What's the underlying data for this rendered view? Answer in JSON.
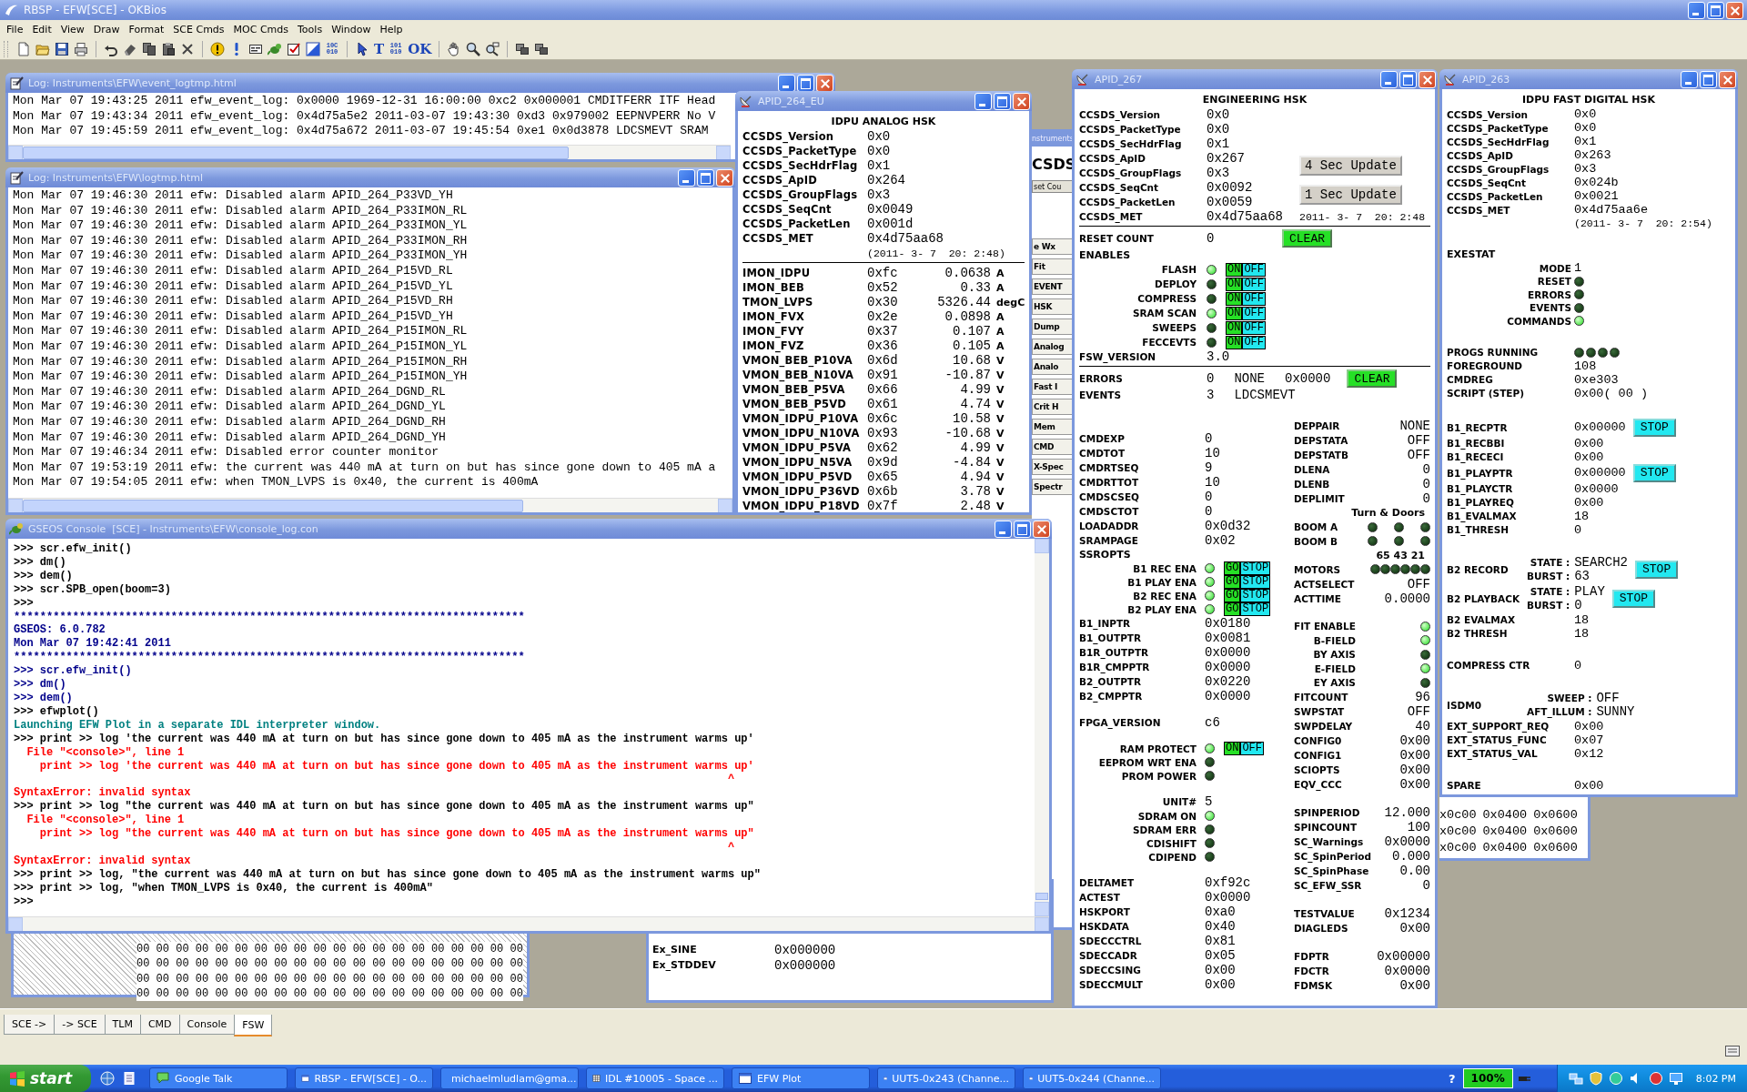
{
  "app": {
    "title": "RBSP - EFW[SCE] - OKBios",
    "menu": [
      "File",
      "Edit",
      "View",
      "Draw",
      "Format",
      "SCE Cmds",
      "MOC Cmds",
      "Tools",
      "Window",
      "Help"
    ],
    "toolbar": [
      {
        "kind": "new"
      },
      {
        "kind": "open"
      },
      {
        "kind": "save"
      },
      {
        "kind": "print"
      },
      {
        "kind": "sep"
      },
      {
        "kind": "undo"
      },
      {
        "kind": "eraser"
      },
      {
        "kind": "copy"
      },
      {
        "kind": "paste"
      },
      {
        "kind": "delete"
      },
      {
        "kind": "sep"
      },
      {
        "kind": "warning"
      },
      {
        "kind": "info"
      },
      {
        "kind": "terminal"
      },
      {
        "kind": "lizard"
      },
      {
        "kind": "check"
      },
      {
        "kind": "chart"
      },
      {
        "kind": "text",
        "text": "10C 010"
      },
      {
        "kind": "sep"
      },
      {
        "kind": "pointer"
      },
      {
        "kind": "text",
        "text": "T"
      },
      {
        "kind": "text",
        "text": "101 010"
      },
      {
        "kind": "text",
        "text": "OK"
      },
      {
        "kind": "sep"
      },
      {
        "kind": "hand"
      },
      {
        "kind": "zoom"
      },
      {
        "kind": "zoomlist"
      },
      {
        "kind": "sep"
      },
      {
        "kind": "tile"
      },
      {
        "kind": "tile"
      }
    ]
  },
  "event_log": {
    "title": "Log: Instruments\\EFW\\event_logtmp.html",
    "lines": [
      "Mon Mar 07 19:43:25 2011 efw_event_log: 0x0000 1969-12-31 16:00:00 0xc2 0x000001 CMDITFERR ITF Head",
      "Mon Mar 07 19:43:34 2011 efw_event_log: 0x4d75a5e2 2011-03-07 19:43:30 0xd3 0x979002 EEPNVPERR No V",
      "Mon Mar 07 19:45:59 2011 efw_event_log: 0x4d75a672 2011-03-07 19:45:54 0xe1 0x0d3878 LDCSMEVT SRAM"
    ]
  },
  "log": {
    "title": "Log: Instruments\\EFW\\logtmp.html",
    "lines": [
      "Mon Mar 07 19:46:30 2011 efw: Disabled alarm APID_264_P33VD_YH",
      "Mon Mar 07 19:46:30 2011 efw: Disabled alarm APID_264_P33IMON_RL",
      "Mon Mar 07 19:46:30 2011 efw: Disabled alarm APID_264_P33IMON_YL",
      "Mon Mar 07 19:46:30 2011 efw: Disabled alarm APID_264_P33IMON_RH",
      "Mon Mar 07 19:46:30 2011 efw: Disabled alarm APID_264_P33IMON_YH",
      "Mon Mar 07 19:46:30 2011 efw: Disabled alarm APID_264_P15VD_RL",
      "Mon Mar 07 19:46:30 2011 efw: Disabled alarm APID_264_P15VD_YL",
      "Mon Mar 07 19:46:30 2011 efw: Disabled alarm APID_264_P15VD_RH",
      "Mon Mar 07 19:46:30 2011 efw: Disabled alarm APID_264_P15VD_YH",
      "Mon Mar 07 19:46:30 2011 efw: Disabled alarm APID_264_P15IMON_RL",
      "Mon Mar 07 19:46:30 2011 efw: Disabled alarm APID_264_P15IMON_YL",
      "Mon Mar 07 19:46:30 2011 efw: Disabled alarm APID_264_P15IMON_RH",
      "Mon Mar 07 19:46:30 2011 efw: Disabled alarm APID_264_P15IMON_YH",
      "Mon Mar 07 19:46:30 2011 efw: Disabled alarm APID_264_DGND_RL",
      "Mon Mar 07 19:46:30 2011 efw: Disabled alarm APID_264_DGND_YL",
      "Mon Mar 07 19:46:30 2011 efw: Disabled alarm APID_264_DGND_RH",
      "Mon Mar 07 19:46:30 2011 efw: Disabled alarm APID_264_DGND_YH",
      "Mon Mar 07 19:46:34 2011 efw: Disabled error counter monitor",
      "Mon Mar 07 19:53:19 2011 efw: the current was 440 mA at turn on but has since gone down to 405 mA a",
      "Mon Mar 07 19:54:05 2011 efw: when TMON_LVPS is 0x40, the current is 400mA"
    ]
  },
  "apid_264": {
    "title": "APID_264_EU",
    "heading": "IDPU ANALOG HSK",
    "header": [
      {
        "label": "CCSDS_Version",
        "value": "0x0"
      },
      {
        "label": "CCSDS_PacketType",
        "value": "0x0"
      },
      {
        "label": "CCSDS_SecHdrFlag",
        "value": "0x1"
      },
      {
        "label": "CCSDS_ApID",
        "value": "0x264"
      },
      {
        "label": "CCSDS_GroupFlags",
        "value": "0x3"
      },
      {
        "label": "CCSDS_SeqCnt",
        "value": "0x0049"
      },
      {
        "label": "CCSDS_PacketLen",
        "value": "0x001d"
      },
      {
        "label": "CCSDS_MET",
        "value": "0x4d75aa68"
      }
    ],
    "met_note": "(2011- 3- 7  20: 2:48)",
    "rows": [
      {
        "label": "IMON_IDPU",
        "raw": "0xfc",
        "reading": "0.0638",
        "unit": "A"
      },
      {
        "label": "IMON_BEB",
        "raw": "0x52",
        "reading": "0.33",
        "unit": "A"
      },
      {
        "label": "TMON_LVPS",
        "raw": "0x30",
        "reading": "5326.44",
        "unit": "degC"
      },
      {
        "label": "IMON_FVX",
        "raw": "0x2e",
        "reading": "0.0898",
        "unit": "A"
      },
      {
        "label": "IMON_FVY",
        "raw": "0x37",
        "reading": "0.107",
        "unit": "A"
      },
      {
        "label": "IMON_FVZ",
        "raw": "0x36",
        "reading": "0.105",
        "unit": "A"
      },
      {
        "label": "VMON_BEB_P10VA",
        "raw": "0x6d",
        "reading": "10.68",
        "unit": "V"
      },
      {
        "label": "VMON_BEB_N10VA",
        "raw": "0x91",
        "reading": "-10.87",
        "unit": "V"
      },
      {
        "label": "VMON_BEB_P5VA",
        "raw": "0x66",
        "reading": "4.99",
        "unit": "V"
      },
      {
        "label": "VMON_BEB_P5VD",
        "raw": "0x61",
        "reading": "4.74",
        "unit": "V"
      },
      {
        "label": "VMON_IDPU_P10VA",
        "raw": "0x6c",
        "reading": "10.58",
        "unit": "V"
      },
      {
        "label": "VMON_IDPU_N10VA",
        "raw": "0x93",
        "reading": "-10.68",
        "unit": "V"
      },
      {
        "label": "VMON_IDPU_P5VA",
        "raw": "0x62",
        "reading": "4.99",
        "unit": "V"
      },
      {
        "label": "VMON_IDPU_N5VA",
        "raw": "0x9d",
        "reading": "-4.84",
        "unit": "V"
      },
      {
        "label": "VMON_IDPU_P5VD",
        "raw": "0x65",
        "reading": "4.94",
        "unit": "V"
      },
      {
        "label": "VMON_IDPU_P36VD",
        "raw": "0x6b",
        "reading": "3.78",
        "unit": "V"
      },
      {
        "label": "VMON_IDPU_P18VD",
        "raw": "0x7f",
        "reading": "2.48",
        "unit": "V"
      }
    ]
  },
  "console": {
    "title": "GSEOS Console  [SCE] - Instruments\\EFW\\console_log.con",
    "lines": [
      {
        "kind": "prompt",
        "text": ">>> scr.efw_init()"
      },
      {
        "kind": "prompt",
        "text": ">>> dm()"
      },
      {
        "kind": "prompt",
        "text": ">>> dem()"
      },
      {
        "kind": "prompt",
        "text": ">>> scr.SPB_open(boom=3)"
      },
      {
        "kind": "prompt",
        "text": ">>>"
      },
      {
        "kind": "log",
        "text": "******************************************************************************"
      },
      {
        "kind": "log",
        "text": "GSEOS: 6.0.782"
      },
      {
        "kind": "log",
        "text": "Mon Mar 07 19:42:41 2011"
      },
      {
        "kind": "log",
        "text": "******************************************************************************"
      },
      {
        "kind": "log",
        "text": ">>> scr.efw_init()"
      },
      {
        "kind": "log",
        "text": ">>> dm()"
      },
      {
        "kind": "log",
        "text": ">>> dem()"
      },
      {
        "kind": "prompt",
        "text": ">>> efwplot()"
      },
      {
        "kind": "notice",
        "text": "Launching EFW Plot in a separate IDL interpreter window."
      },
      {
        "kind": "prompt",
        "text": ">>> print >> log 'the current was 440 mA at turn on but has since gone down to 405 mA as the instrument warms up'"
      },
      {
        "kind": "error",
        "text": "  File \"<console>\", line 1"
      },
      {
        "kind": "error",
        "text": "    print >> log 'the current was 440 mA at turn on but has since gone down to 405 mA as the instrument warms up'"
      },
      {
        "kind": "caret",
        "text": "^"
      },
      {
        "kind": "error",
        "text": "SyntaxError: invalid syntax"
      },
      {
        "kind": "prompt",
        "text": ">>> print >> log \"the current was 440 mA at turn on but has since gone down to 405 mA as the instrument warms up\""
      },
      {
        "kind": "error",
        "text": "  File \"<console>\", line 1"
      },
      {
        "kind": "error",
        "text": "    print >> log \"the current was 440 mA at turn on but has since gone down to 405 mA as the instrument warms up\""
      },
      {
        "kind": "caret",
        "text": "^"
      },
      {
        "kind": "error",
        "text": "SyntaxError: invalid syntax"
      },
      {
        "kind": "prompt",
        "text": ">>> print >> log, \"the current was 440 mA at turn on but has since gone down to 405 mA as the instrument warms up\""
      },
      {
        "kind": "prompt",
        "text": ">>> print >> log, \"when TMON_LVPS is 0x40, the current is 400mA\""
      },
      {
        "kind": "prompt",
        "text": ">>>"
      }
    ]
  },
  "apid_267": {
    "title": "APID_267",
    "heading": "ENGINEERING HSK",
    "top": [
      {
        "kind": "field",
        "label": "CCSDS_Version",
        "value": "0x0"
      },
      {
        "kind": "field",
        "label": "CCSDS_PacketType",
        "value": "0x0"
      },
      {
        "kind": "field",
        "label": "CCSDS_SecHdrFlag",
        "value": "0x1"
      },
      {
        "kind": "field",
        "label": "CCSDS_ApID",
        "value": "0x267",
        "buttons": [
          {
            "kind": "update",
            "text": "4 Sec Update"
          }
        ]
      },
      {
        "kind": "field",
        "label": "CCSDS_GroupFlags",
        "value": "0x3"
      },
      {
        "kind": "field",
        "label": "CCSDS_SeqCnt",
        "value": "0x0092",
        "buttons": [
          {
            "kind": "update",
            "text": "1 Sec Update"
          }
        ]
      },
      {
        "kind": "field",
        "label": "CCSDS_PacketLen",
        "value": "0x0059"
      },
      {
        "kind": "field",
        "label": "CCSDS_MET",
        "value": "0x4d75aa68",
        "note": "2011- 3- 7  20: 2:48"
      }
    ],
    "enables": [
      {
        "kind": "field",
        "label": "RESET COUNT",
        "value": "0",
        "buttons": [
          {
            "kind": "clear",
            "text": "CLEAR"
          }
        ]
      },
      {
        "kind": "heading",
        "label": "ENABLES"
      },
      {
        "kind": "indicator",
        "label": "FLASH",
        "leds": [
          {
            "on": true
          }
        ],
        "buttons": [
          {
            "kind": "on",
            "text": "ON"
          },
          {
            "kind": "off",
            "text": "OFF"
          }
        ]
      },
      {
        "kind": "indicator",
        "label": "DEPLOY",
        "leds": [
          {
            "on": false
          }
        ],
        "buttons": [
          {
            "kind": "on",
            "text": "ON"
          },
          {
            "kind": "off",
            "text": "OFF"
          }
        ]
      },
      {
        "kind": "indicator",
        "label": "COMPRESS",
        "leds": [
          {
            "on": false
          }
        ],
        "buttons": [
          {
            "kind": "on",
            "text": "ON"
          },
          {
            "kind": "off",
            "text": "OFF"
          }
        ]
      },
      {
        "kind": "indicator",
        "label": "SRAM SCAN",
        "leds": [
          {
            "on": true
          }
        ],
        "buttons": [
          {
            "kind": "on",
            "text": "ON"
          },
          {
            "kind": "off",
            "text": "OFF"
          }
        ]
      },
      {
        "kind": "indicator",
        "label": "SWEEPS",
        "leds": [
          {
            "on": false
          }
        ],
        "buttons": [
          {
            "kind": "on",
            "text": "ON"
          },
          {
            "kind": "off",
            "text": "OFF"
          }
        ]
      },
      {
        "kind": "indicator",
        "label": "FECCEVTS",
        "leds": [
          {
            "on": false
          }
        ],
        "buttons": [
          {
            "kind": "on",
            "text": "ON"
          },
          {
            "kind": "off",
            "text": "OFF"
          }
        ]
      },
      {
        "kind": "field",
        "label": "FSW_VERSION",
        "value": "3.0"
      }
    ],
    "events": [
      {
        "kind": "field",
        "label": "ERRORS",
        "values": [
          "0",
          "NONE",
          "0x0000"
        ],
        "buttons": [
          {
            "kind": "clear",
            "text": "CLEAR"
          }
        ]
      },
      {
        "kind": "field",
        "label": "EVENTS",
        "values": [
          "3",
          "LDCSMEVT"
        ]
      }
    ],
    "left": [
      [
        {
          "kind": "field",
          "label": "CMDEXP",
          "value": "0"
        },
        {
          "kind": "field",
          "label": "CMDTOT",
          "value": "10"
        },
        {
          "kind": "field",
          "label": "CMDRTSEQ",
          "value": "9"
        },
        {
          "kind": "field",
          "label": "CMDRTTOT",
          "value": "10"
        },
        {
          "kind": "field",
          "label": "CMDSCSEQ",
          "value": "0"
        },
        {
          "kind": "field",
          "label": "CMDSCTOT",
          "value": "0"
        },
        {
          "kind": "field",
          "label": "LOADADDR",
          "value": "0x0d32"
        },
        {
          "kind": "field",
          "label": "SRAMPAGE",
          "value": "0x02"
        },
        {
          "kind": "heading",
          "label": "SSROPTS"
        },
        {
          "kind": "indicator",
          "label": "B1 REC ENA",
          "leds": [
            {
              "on": true
            }
          ],
          "buttons": [
            {
              "kind": "go",
              "text": "GO"
            },
            {
              "kind": "halt",
              "text": "STOP"
            }
          ]
        },
        {
          "kind": "indicator",
          "label": "B1 PLAY ENA",
          "leds": [
            {
              "on": true
            }
          ],
          "buttons": [
            {
              "kind": "go",
              "text": "GO"
            },
            {
              "kind": "halt",
              "text": "STOP"
            }
          ]
        },
        {
          "kind": "indicator",
          "label": "B2 REC ENA",
          "leds": [
            {
              "on": true
            }
          ],
          "buttons": [
            {
              "kind": "go",
              "text": "GO"
            },
            {
              "kind": "halt",
              "text": "STOP"
            }
          ]
        },
        {
          "kind": "indicator",
          "label": "B2 PLAY ENA",
          "leds": [
            {
              "on": true
            }
          ],
          "buttons": [
            {
              "kind": "go",
              "text": "GO"
            },
            {
              "kind": "halt",
              "text": "STOP"
            }
          ]
        },
        {
          "kind": "field",
          "label": "B1_INPTR",
          "value": "0x0180"
        },
        {
          "kind": "field",
          "label": "B1_OUTPTR",
          "value": "0x0081"
        },
        {
          "kind": "field",
          "label": "B1R_OUTPTR",
          "value": "0x0000"
        },
        {
          "kind": "field",
          "label": "B1R_CMPPTR",
          "value": "0x0000"
        },
        {
          "kind": "field",
          "label": "B2_OUTPTR",
          "value": "0x0220"
        },
        {
          "kind": "field",
          "label": "B2_CMPPTR",
          "value": "0x0000"
        }
      ],
      [
        {
          "kind": "field",
          "label": "FPGA_VERSION",
          "value": "c6"
        }
      ],
      [
        {
          "kind": "indicator",
          "label": "RAM PROTECT",
          "leds": [
            {
              "on": true
            }
          ],
          "buttons": [
            {
              "kind": "on",
              "text": "ON"
            },
            {
              "kind": "off",
              "text": "OFF"
            }
          ]
        },
        {
          "kind": "indicator",
          "label": "EEPROM WRT ENA",
          "leds": [
            {
              "on": false
            }
          ]
        },
        {
          "kind": "indicator",
          "label": "PROM POWER",
          "leds": [
            {
              "on": false
            }
          ]
        }
      ],
      [
        {
          "kind": "indicator",
          "label": "UNIT#",
          "value": "5"
        },
        {
          "kind": "indicator",
          "label": "SDRAM ON",
          "leds": [
            {
              "on": true
            }
          ]
        },
        {
          "kind": "indicator",
          "label": "SDRAM ERR",
          "leds": [
            {
              "on": false
            }
          ]
        },
        {
          "kind": "indicator",
          "label": "CDISHIFT",
          "leds": [
            {
              "on": false
            }
          ]
        },
        {
          "kind": "indicator",
          "label": "CDIPEND",
          "leds": [
            {
              "on": false
            }
          ]
        }
      ],
      [
        {
          "kind": "field",
          "label": "DELTAMET",
          "value": "0xf92c"
        },
        {
          "kind": "field",
          "label": "ACTEST",
          "value": "0x0000"
        },
        {
          "kind": "field",
          "label": "HSKPORT",
          "value": "0xa0"
        },
        {
          "kind": "field",
          "label": "HSKDATA",
          "value": "0x40"
        },
        {
          "kind": "field",
          "label": "SDECCCTRL",
          "value": "0x81"
        },
        {
          "kind": "field",
          "label": "SDECCADR",
          "value": "0x05"
        },
        {
          "kind": "field",
          "label": "SDECCSING",
          "value": "0x00"
        },
        {
          "kind": "field",
          "label": "SDECCMULT",
          "value": "0x00"
        }
      ]
    ],
    "right": [
      [
        {
          "kind": "field",
          "label": "DEPPAIR",
          "value": "NONE"
        },
        {
          "kind": "field",
          "label": "DEPSTATA",
          "value": "OFF"
        },
        {
          "kind": "field",
          "label": "DEPSTATB",
          "value": "OFF"
        },
        {
          "kind": "field",
          "label": "DLENA",
          "value": "0"
        },
        {
          "kind": "field",
          "label": "DLENB",
          "value": "0"
        },
        {
          "kind": "field",
          "label": "DEPLIMIT",
          "value": "0"
        },
        {
          "kind": "heading",
          "label": "Turn & Doors"
        },
        {
          "kind": "field",
          "label": "BOOM A",
          "leds": [
            {
              "on": false
            },
            {
              "on": false
            },
            {
              "on": false
            }
          ]
        },
        {
          "kind": "field",
          "label": "BOOM B",
          "leds": [
            {
              "on": false
            },
            {
              "on": false
            },
            {
              "on": false
            }
          ]
        },
        {
          "kind": "heading",
          "label": "65 43 21"
        },
        {
          "kind": "field",
          "label": "MOTORS",
          "leds": [
            {
              "on": false
            },
            {
              "on": false
            },
            {
              "on": false
            },
            {
              "on": false
            },
            {
              "on": false
            },
            {
              "on": false
            }
          ]
        },
        {
          "kind": "field",
          "label": "ACTSELECT",
          "value": "OFF"
        },
        {
          "kind": "field",
          "label": "ACTTIME",
          "value": "0.0000"
        }
      ],
      [
        {
          "kind": "indicator",
          "label": "FIT ENABLE",
          "leds": [
            {
              "on": true
            }
          ]
        },
        {
          "kind": "indicator",
          "label": "B-FIELD",
          "leds": [
            {
              "on": true
            }
          ]
        },
        {
          "kind": "indicator",
          "label": "BY AXIS",
          "leds": [
            {
              "on": false
            }
          ]
        },
        {
          "kind": "indicator",
          "label": "E-FIELD",
          "leds": [
            {
              "on": true
            }
          ]
        },
        {
          "kind": "indicator",
          "label": "EY AXIS",
          "leds": [
            {
              "on": false
            }
          ]
        },
        {
          "kind": "field",
          "label": "FITCOUNT",
          "value": "96"
        },
        {
          "kind": "field",
          "label": "SWPSTAT",
          "value": "OFF"
        },
        {
          "kind": "field",
          "label": "SWPDELAY",
          "value": "40"
        },
        {
          "kind": "field",
          "label": "CONFIG0",
          "value": "0x00"
        },
        {
          "kind": "field",
          "label": "CONFIG1",
          "value": "0x00"
        },
        {
          "kind": "field",
          "label": "SCIOPTS",
          "value": "0x00"
        },
        {
          "kind": "field",
          "label": "EQV_CCC",
          "value": "0x00"
        }
      ],
      [
        {
          "kind": "field",
          "label": "SPINPERIOD",
          "value": "12.000"
        },
        {
          "kind": "field",
          "label": "SPINCOUNT",
          "value": "100"
        },
        {
          "kind": "field",
          "label": "SC_Warnings",
          "value": "0x0000"
        },
        {
          "kind": "field",
          "label": "SC_SpinPeriod",
          "value": "0.000"
        },
        {
          "kind": "field",
          "label": "SC_SpinPhase",
          "value": "0.00"
        },
        {
          "kind": "field",
          "label": "SC_EFW_SSR",
          "value": "0"
        }
      ],
      [
        {
          "kind": "field",
          "label": "TESTVALUE",
          "value": "0x1234"
        },
        {
          "kind": "field",
          "label": "DIAGLEDS",
          "value": "0x00"
        }
      ],
      [
        {
          "kind": "field",
          "label": "FDPTR",
          "value": "0x00000"
        },
        {
          "kind": "field",
          "label": "FDCTR",
          "value": "0x0000"
        },
        {
          "kind": "field",
          "label": "FDMSK",
          "value": "0x00"
        }
      ]
    ]
  },
  "apid_263": {
    "title": "APID_263",
    "heading": "IDPU FAST DIGITAL HSK",
    "groups": [
      [
        {
          "kind": "field",
          "label": "CCSDS_Version",
          "value": "0x0"
        },
        {
          "kind": "field",
          "label": "CCSDS_PacketType",
          "value": "0x0"
        },
        {
          "kind": "field",
          "label": "CCSDS_SecHdrFlag",
          "value": "0x1"
        },
        {
          "kind": "field",
          "label": "CCSDS_ApID",
          "value": "0x263"
        },
        {
          "kind": "field",
          "label": "CCSDS_GroupFlags",
          "value": "0x3"
        },
        {
          "kind": "field",
          "label": "CCSDS_SeqCnt",
          "value": "0x024b"
        },
        {
          "kind": "field",
          "label": "CCSDS_PacketLen",
          "value": "0x0021"
        },
        {
          "kind": "field",
          "label": "CCSDS_MET",
          "value": "0x4d75aa6e"
        },
        {
          "kind": "note",
          "note": "(2011- 3- 7  20: 2:54)"
        }
      ],
      [
        {
          "kind": "heading",
          "label": "EXESTAT"
        },
        {
          "kind": "indicator",
          "label": "MODE",
          "value": "1"
        },
        {
          "kind": "indicator",
          "label": "RESET",
          "leds": [
            {
              "on": false
            }
          ]
        },
        {
          "kind": "indicator",
          "label": "ERRORS",
          "leds": [
            {
              "on": false
            }
          ]
        },
        {
          "kind": "indicator",
          "label": "EVENTS",
          "leds": [
            {
              "on": false
            }
          ]
        },
        {
          "kind": "indicator",
          "label": "COMMANDS",
          "leds": [
            {
              "on": true
            }
          ]
        }
      ],
      [
        {
          "kind": "field",
          "label": "PROGS RUNNING",
          "leds": [
            {
              "on": false
            },
            {
              "on": false
            },
            {
              "on": false
            },
            {
              "on": false
            }
          ]
        },
        {
          "kind": "field",
          "label": "FOREGROUND",
          "value": "108"
        },
        {
          "kind": "field",
          "label": "CMDREG",
          "value": "0xe303"
        },
        {
          "kind": "field",
          "label": "SCRIPT (STEP)",
          "value": "0x00( 00 )"
        }
      ],
      [
        {
          "kind": "field",
          "label": "B1_RECPTR",
          "value": "0x00000",
          "buttons": [
            {
              "kind": "stop",
              "text": "STOP"
            }
          ]
        },
        {
          "kind": "field",
          "label": "B1_RECBBI",
          "value": "0x00"
        },
        {
          "kind": "field",
          "label": "B1_RECECI",
          "value": "0x00"
        },
        {
          "kind": "field",
          "label": "B1_PLAYPTR",
          "value": "0x00000",
          "buttons": [
            {
              "kind": "stop",
              "text": "STOP"
            }
          ]
        },
        {
          "kind": "field",
          "label": "B1_PLAYCTR",
          "value": "0x0000"
        },
        {
          "kind": "field",
          "label": "B1_PLAYREQ",
          "value": "0x00"
        },
        {
          "kind": "field",
          "label": "B1_EVALMAX",
          "value": "18"
        },
        {
          "kind": "field",
          "label": "B1_THRESH",
          "value": "0"
        }
      ],
      [
        {
          "kind": "state",
          "label": "B2 RECORD",
          "pairs": [
            {
              "label": "STATE :",
              "value": "SEARCH2"
            },
            {
              "label": "BURST :",
              "value": "63"
            }
          ],
          "buttons": [
            {
              "kind": "stop",
              "text": "STOP"
            }
          ]
        },
        {
          "kind": "state",
          "label": "B2 PLAYBACK",
          "pairs": [
            {
              "label": "STATE :",
              "value": "PLAY"
            },
            {
              "label": "BURST :",
              "value": "0"
            }
          ],
          "buttons": [
            {
              "kind": "stop",
              "text": "STOP"
            }
          ]
        },
        {
          "kind": "field",
          "label": "B2 EVALMAX",
          "value": "18"
        },
        {
          "kind": "field",
          "label": "B2 THRESH",
          "value": "18"
        }
      ],
      [
        {
          "kind": "field",
          "label": "COMPRESS CTR",
          "value": "0"
        }
      ],
      [
        {
          "kind": "state",
          "label": "ISDM0",
          "pairs": [
            {
              "label": "SWEEP :",
              "value": "OFF"
            },
            {
              "label": "AFT_ILLUM :",
              "value": "SUNNY"
            }
          ]
        },
        {
          "kind": "field",
          "label": "EXT_SUPPORT_REQ",
          "value": "0x00"
        },
        {
          "kind": "field",
          "label": "EXT_STATUS_FUNC",
          "value": "0x07"
        },
        {
          "kind": "field",
          "label": "EXT_STATUS_VAL",
          "value": "0x12"
        }
      ],
      [
        {
          "kind": "field",
          "label": "SPARE",
          "value": "0x00"
        }
      ]
    ]
  },
  "background": {
    "strip": {
      "title": "nstruments",
      "big": "CSDS",
      "button": "set Cou",
      "items": [
        "e Wx",
        "Fit",
        "EVENT",
        "HSK",
        "Dump",
        "Analog",
        "Analo",
        "Fast I",
        "Crit H",
        "Mem",
        "CMD",
        "X-Spec",
        "Spectr"
      ]
    },
    "hex_dump": [
      "00 00 00 00 00 00 00 00 00 00 00 00 00 00 00 00 00 00 00 00",
      "00 00 00 00 00 00 00 00 00 00 00 00 00 00 00 00 00 00 00 00",
      "00 00 00 00 00 00 00 00 00 00 00 00 00 00 00 00 00 00 00 00",
      "00 00 00 00 00 00 00 00 00 00 00 00 00 00 00 00 00 00 00 00"
    ],
    "ex_fields": [
      {
        "label": "Ex_SINE",
        "value": "0x000000"
      },
      {
        "label": "Ex_STDDEV",
        "value": "0x000000"
      }
    ],
    "grid": [
      [
        "x0c00",
        "0x0400",
        "0x0600"
      ],
      [
        "x0c00",
        "0x0400",
        "0x0600"
      ],
      [
        "x0c00",
        "0x0400",
        "0x0600"
      ]
    ]
  },
  "tabs": [
    {
      "label": "SCE ->",
      "selected": false
    },
    {
      "label": "-> SCE",
      "selected": false
    },
    {
      "label": "TLM",
      "selected": false
    },
    {
      "label": "CMD",
      "selected": false
    },
    {
      "label": "Console",
      "selected": false
    },
    {
      "label": "FSW",
      "selected": true
    }
  ],
  "taskbar": {
    "start": "start",
    "tasks": [
      {
        "kind": "chat",
        "label": "Google Talk"
      },
      {
        "kind": "window",
        "label": "RBSP - EFW[SCE] - O..."
      },
      {
        "kind": "mail",
        "label": "michaelmludlam@gma..."
      },
      {
        "kind": "grid",
        "label": "IDL #10005 - Space ..."
      },
      {
        "kind": "window",
        "label": "EFW Plot"
      },
      {
        "kind": "window",
        "label": "UUT5-0x243 (Channe..."
      },
      {
        "kind": "window",
        "label": "UUT5-0x244 (Channe..."
      }
    ],
    "help": "?",
    "zoom": "100%",
    "clock": "8:02 PM"
  }
}
